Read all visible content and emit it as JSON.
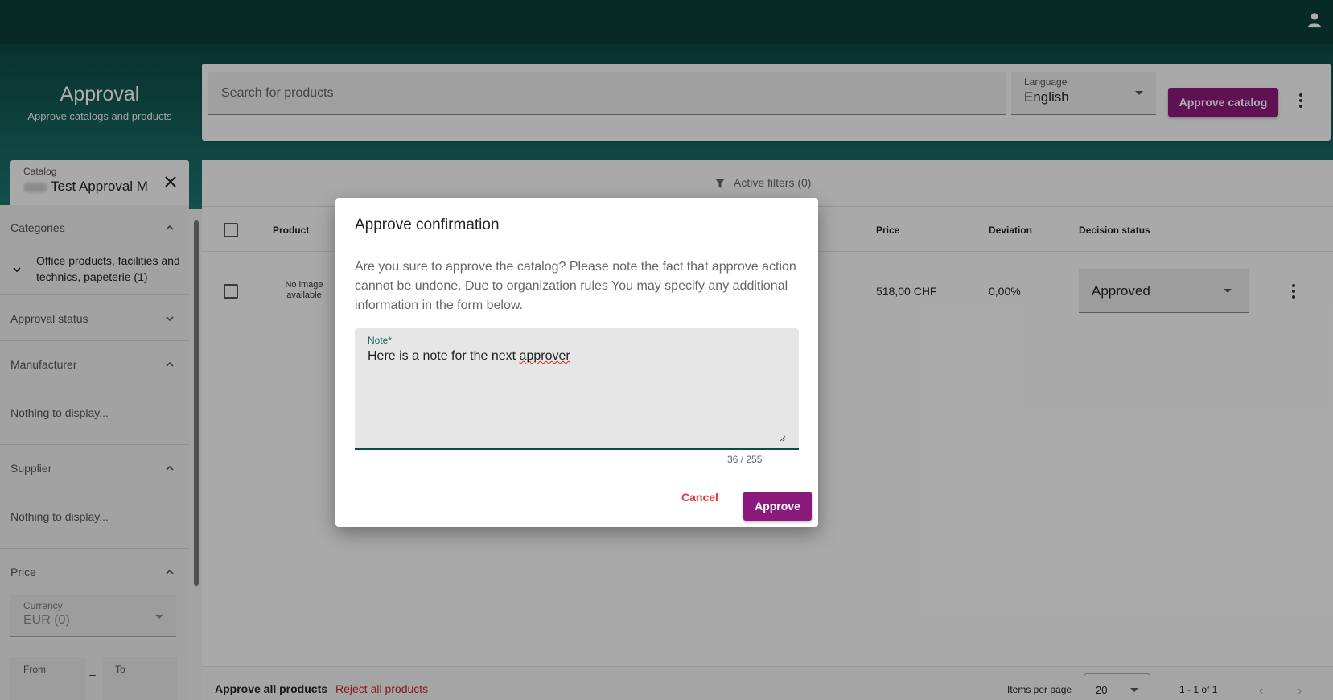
{
  "header": {
    "title": "Approval",
    "subtitle": "Approve catalogs and products",
    "user_icon": "user-icon"
  },
  "search": {
    "placeholder": "Search for products",
    "language_label": "Language",
    "language_value": "English",
    "approve_catalog_label": "Approve catalog"
  },
  "catalog": {
    "label": "Catalog",
    "value": "Test Approval M"
  },
  "sidebar": {
    "categories_label": "Categories",
    "category_item": "Office products, facilities and technics, papeterie (1)",
    "approval_status_label": "Approval status",
    "manufacturer_label": "Manufacturer",
    "manufacturer_empty": "Nothing to display...",
    "supplier_label": "Supplier",
    "supplier_empty": "Nothing to display...",
    "price_label": "Price",
    "currency_label": "Currency",
    "currency_value": "EUR (0)",
    "from_label": "From",
    "to_label": "To"
  },
  "table": {
    "active_filters": "Active filters (0)",
    "columns": {
      "product": "Product",
      "price": "Price",
      "deviation": "Deviation",
      "decision_status": "Decision status"
    },
    "rows": [
      {
        "image_text": "No image available",
        "price": "518,00 CHF",
        "deviation": "0,00%",
        "decision": "Approved"
      }
    ]
  },
  "footer": {
    "approve_all": "Approve all products",
    "reject_all": "Reject all products",
    "items_per_page_label": "Items per page",
    "items_per_page_value": "20",
    "range": "1 - 1 of 1"
  },
  "dialog": {
    "title": "Approve confirmation",
    "body": "Are you sure to approve the catalog? Please note the fact that approve action cannot be undone. Due to organization rules You may specify any additional information in the form below.",
    "note_label": "Note*",
    "note_value_prefix": "Here is a note for the next ",
    "note_value_misspelled": "approver",
    "counter": "36 / 255",
    "cancel_label": "Cancel",
    "approve_label": "Approve"
  },
  "colors": {
    "brand_dark": "#0c3e3a",
    "accent_purple": "#8c1a7d",
    "danger_red": "#e53935"
  }
}
